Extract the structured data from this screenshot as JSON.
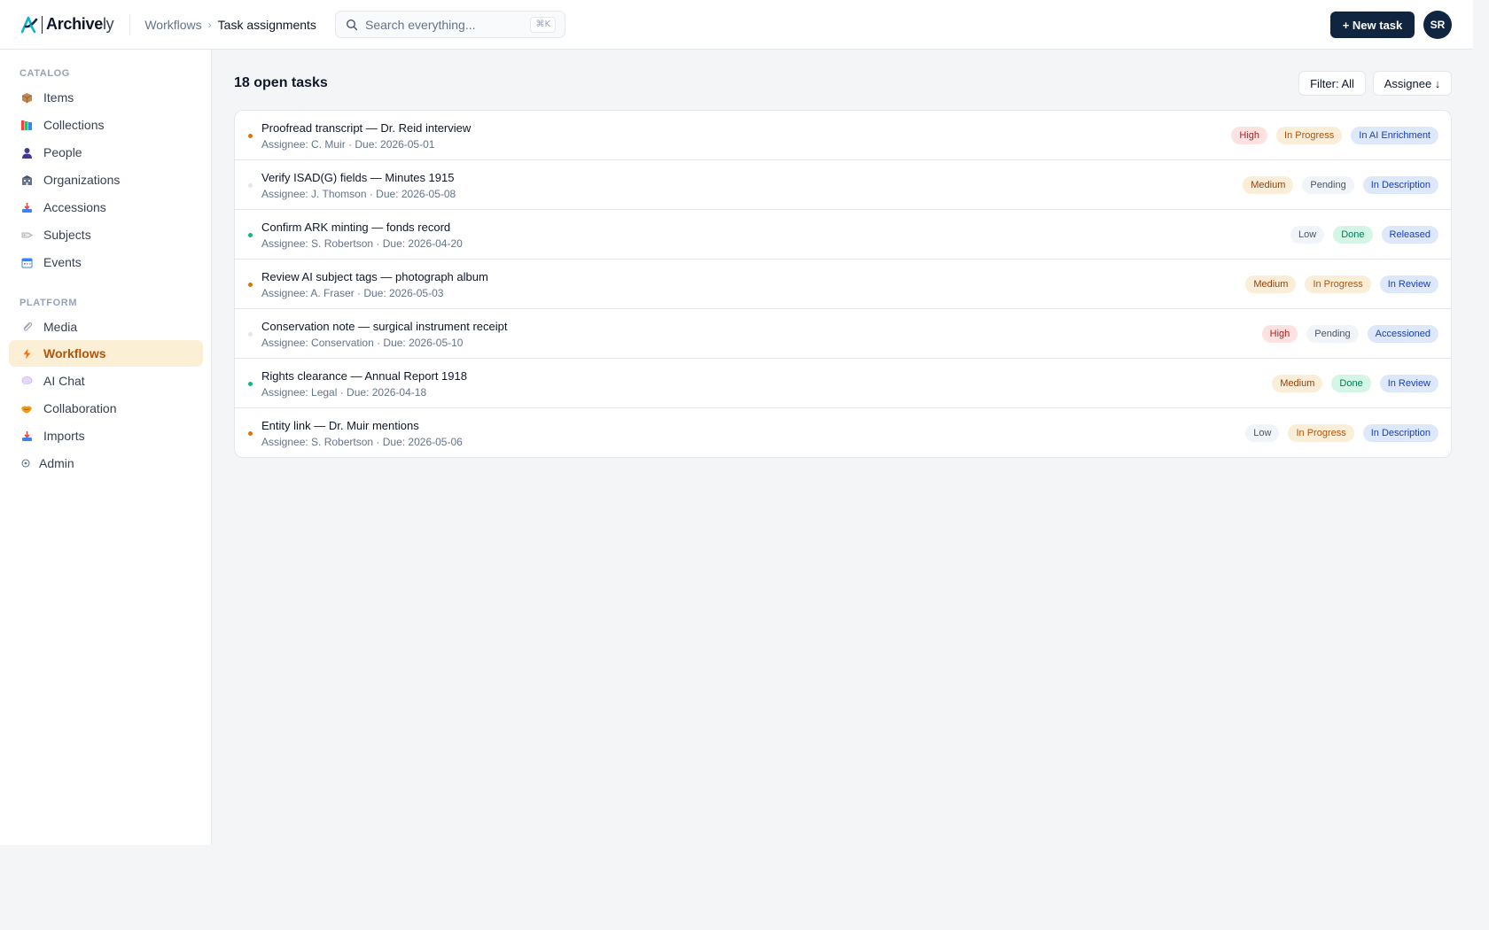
{
  "app": {
    "logo_brand": "Archive",
    "logo_suffix": "ly"
  },
  "breadcrumb": {
    "parent": "Workflows",
    "current": "Task assignments"
  },
  "search": {
    "placeholder": "Search everything...",
    "shortcut": "⌘K"
  },
  "header": {
    "new_task_label": "+ New task",
    "avatar_initials": "SR"
  },
  "sidebar": {
    "catalog_label": "CATALOG",
    "platform_label": "PLATFORM",
    "catalog_items": [
      {
        "label": "Items",
        "icon": "package-icon"
      },
      {
        "label": "Collections",
        "icon": "books-icon"
      },
      {
        "label": "People",
        "icon": "person-icon"
      },
      {
        "label": "Organizations",
        "icon": "building-icon"
      },
      {
        "label": "Accessions",
        "icon": "inbox-tray-icon"
      },
      {
        "label": "Subjects",
        "icon": "tag-icon"
      },
      {
        "label": "Events",
        "icon": "calendar-icon"
      }
    ],
    "platform_items": [
      {
        "label": "Media",
        "icon": "paperclip-icon"
      },
      {
        "label": "Workflows",
        "icon": "lightning-icon",
        "active": true
      },
      {
        "label": "AI Chat",
        "icon": "speech-bubble-icon"
      },
      {
        "label": "Collaboration",
        "icon": "handshake-icon"
      },
      {
        "label": "Imports",
        "icon": "import-tray-icon"
      },
      {
        "label": "Admin",
        "icon": "gear-icon"
      }
    ]
  },
  "main": {
    "title": "18 open tasks",
    "filter_label": "Filter: All",
    "sort_label": "Assignee ↓"
  },
  "tasks": [
    {
      "title": "Proofread transcript — Dr. Reid interview",
      "meta": "Assignee: C. Muir · Due: 2026-05-01",
      "priority": "High",
      "status": "In Progress",
      "stage": "In AI Enrichment"
    },
    {
      "title": "Verify ISAD(G) fields — Minutes 1915",
      "meta": "Assignee: J. Thomson · Due: 2026-05-08",
      "priority": "Medium",
      "status": "Pending",
      "stage": "In Description"
    },
    {
      "title": "Confirm ARK minting — fonds record",
      "meta": "Assignee: S. Robertson · Due: 2026-04-20",
      "priority": "Low",
      "status": "Done",
      "stage": "Released"
    },
    {
      "title": "Review AI subject tags — photograph album",
      "meta": "Assignee: A. Fraser · Due: 2026-05-03",
      "priority": "Medium",
      "status": "In Progress",
      "stage": "In Review"
    },
    {
      "title": "Conservation note — surgical instrument receipt",
      "meta": "Assignee: Conservation · Due: 2026-05-10",
      "priority": "High",
      "status": "Pending",
      "stage": "Accessioned"
    },
    {
      "title": "Rights clearance — Annual Report 1918",
      "meta": "Assignee: Legal · Due: 2026-04-18",
      "priority": "Medium",
      "status": "Done",
      "stage": "In Review"
    },
    {
      "title": "Entity link — Dr. Muir mentions",
      "meta": "Assignee: S. Robertson · Due: 2026-05-06",
      "priority": "Low",
      "status": "In Progress",
      "stage": "In Description"
    }
  ],
  "colors": {
    "brand_navy": "#0f2540",
    "accent_amber": "#b45309",
    "status_in_progress_dot": "#d97706",
    "status_done_dot": "#10b981",
    "status_pending_dot": "#e5e7eb"
  }
}
